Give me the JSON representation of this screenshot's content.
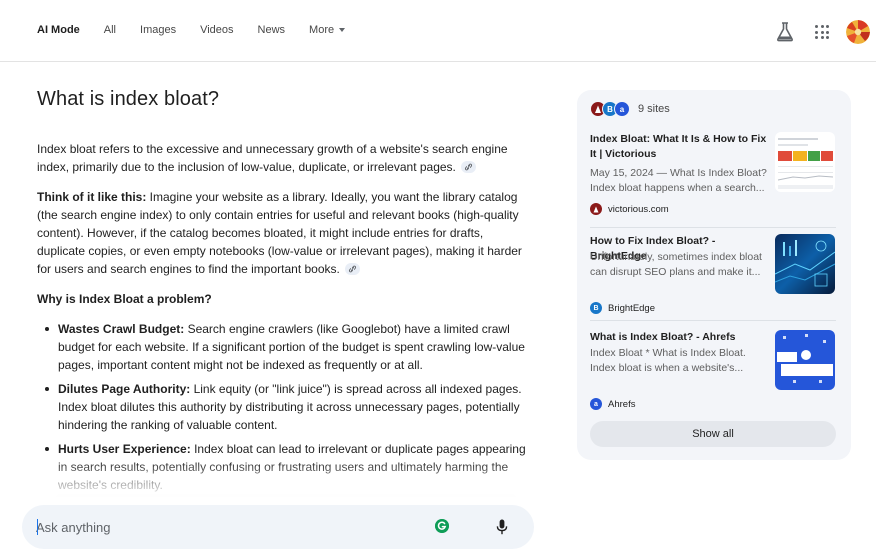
{
  "nav": {
    "tabs": [
      {
        "label": "AI Mode",
        "active": true
      },
      {
        "label": "All"
      },
      {
        "label": "Images"
      },
      {
        "label": "Videos"
      },
      {
        "label": "News"
      }
    ],
    "more_label": "More"
  },
  "icons": {
    "labs": "flask-icon",
    "apps": "apps-grid-icon",
    "avatar": "profile-avatar",
    "mic": "mic-icon",
    "grammarly": "grammarly-icon"
  },
  "answer": {
    "question": "What is index bloat?",
    "intro": "Index bloat refers to the excessive and unnecessary growth of a website's search engine index, primarily due to the inclusion of low-value, duplicate, or irrelevant pages.",
    "analogy_lead": "Think of it like this:",
    "analogy_body": " Imagine your website as a library. Ideally, you want the library catalog (the search engine index) to only contain entries for useful and relevant books (high-quality content). However, if the catalog becomes bloated, it might include entries for drafts, duplicate copies, or even empty notebooks (low-value or irrelevant pages), making it harder for users and search engines to find the important books.",
    "problem_heading": "Why is Index Bloat a problem?",
    "bullets": [
      {
        "lead": "Wastes Crawl Budget:",
        "body": " Search engine crawlers (like Googlebot) have a limited crawl budget for each website. If a significant portion of the budget is spent crawling low-value pages, important content might not be indexed as frequently or at all."
      },
      {
        "lead": "Dilutes Page Authority:",
        "body": " Link equity (or \"link juice\") is spread across all indexed pages. Index bloat dilutes this authority by distributing it across unnecessary pages, potentially hindering the ranking of valuable content."
      },
      {
        "lead": "Hurts User Experience:",
        "body": " Index bloat can lead to irrelevant or duplicate pages appearing in search results, potentially confusing or frustrating users and ultimately harming the website's credibility."
      }
    ]
  },
  "prompt": {
    "placeholder": "Ask anything"
  },
  "sources": {
    "count_label": "9 sites",
    "items": [
      {
        "title": "Index Bloat: What It Is & How to Fix It | Victorious",
        "snippet": "May 15, 2024 — What Is Index Bloat? Index bloat happens when a search...",
        "site": "victorious.com",
        "fav_letter": "",
        "fav_color": "#8b1a1a"
      },
      {
        "title": "How to Fix Index Bloat? - BrightEdge",
        "snippet": "Unfortunately, sometimes index bloat can disrupt SEO plans and make it...",
        "site": "BrightEdge",
        "fav_letter": "B",
        "fav_color": "#1877c9"
      },
      {
        "title": "What is Index Bloat? - Ahrefs",
        "snippet": "Index Bloat * What is Index Bloat. Index bloat is when a website's...",
        "site": "Ahrefs",
        "fav_letter": "a",
        "fav_color": "#2556d9"
      }
    ],
    "show_all_label": "Show all"
  },
  "colors": {
    "accent": "#1a73e8",
    "panel_bg": "#f3f5f9",
    "prompt_bg": "#f0f4f9"
  }
}
